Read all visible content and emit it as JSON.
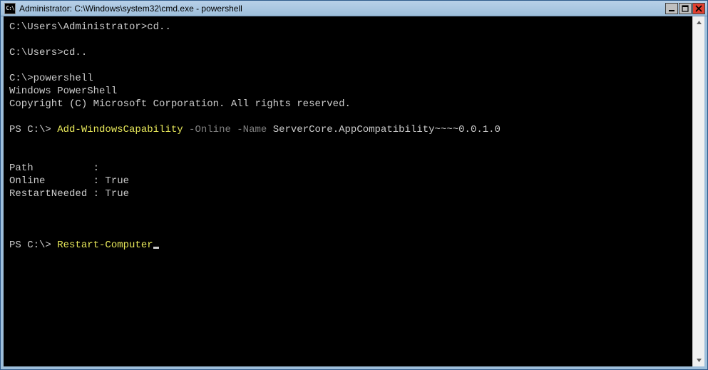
{
  "window": {
    "icon_label": "C:\\",
    "title": "Administrator: C:\\Windows\\system32\\cmd.exe - powershell"
  },
  "terminal": {
    "line1_prompt": "C:\\Users\\Administrator>",
    "line1_cmd": "cd..",
    "line2_prompt": "C:\\Users>",
    "line2_cmd": "cd..",
    "line3_prompt": "C:\\>",
    "line3_cmd": "powershell",
    "ps_banner1": "Windows PowerShell",
    "ps_banner2": "Copyright (C) Microsoft Corporation. All rights reserved.",
    "ps_prompt1": "PS C:\\> ",
    "ps_cmdlet1": "Add-WindowsCapability",
    "ps_param1": " -Online",
    "ps_param2": " -Name",
    "ps_arg1": " ServerCore.AppCompatibility~~~~0.0.1.0",
    "out_path": "Path          :",
    "out_online": "Online        : True",
    "out_restart": "RestartNeeded : True",
    "ps_prompt2": "PS C:\\> ",
    "ps_cmdlet2": "Restart-Computer"
  }
}
